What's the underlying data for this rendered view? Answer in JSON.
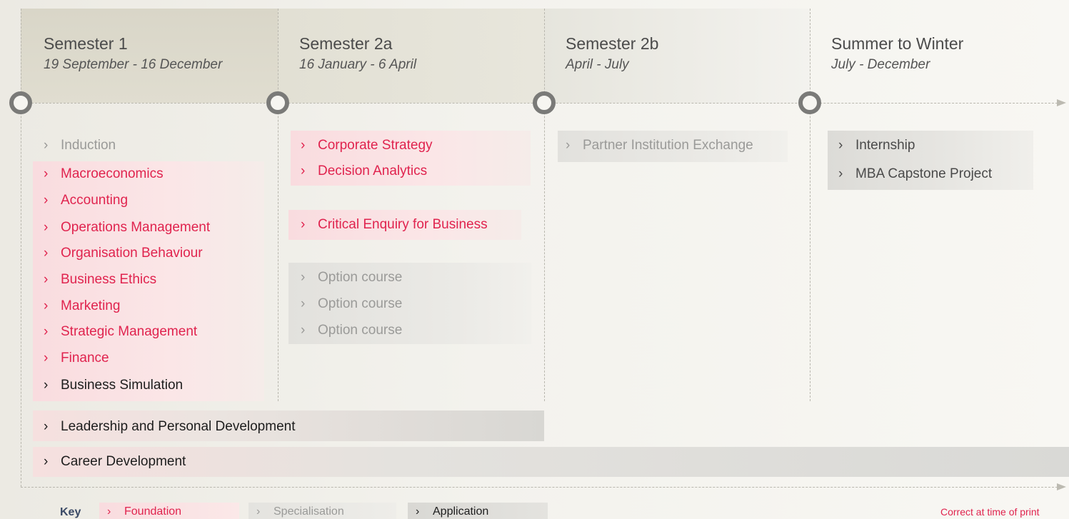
{
  "semesters": [
    {
      "title": "Semester 1",
      "dates": "19 September - 16 December"
    },
    {
      "title": "Semester 2a",
      "dates": "16 January - 6 April"
    },
    {
      "title": "Semester 2b",
      "dates": "April - July"
    },
    {
      "title": "Summer to Winter",
      "dates": "July - December"
    }
  ],
  "chevron": "›",
  "semester1_courses": [
    {
      "label": "Induction",
      "type": "specialisation"
    },
    {
      "label": "Macroeconomics",
      "type": "foundation"
    },
    {
      "label": "Accounting",
      "type": "foundation"
    },
    {
      "label": "Operations Management",
      "type": "foundation"
    },
    {
      "label": "Organisation Behaviour",
      "type": "foundation"
    },
    {
      "label": "Business Ethics",
      "type": "foundation"
    },
    {
      "label": "Marketing",
      "type": "foundation"
    },
    {
      "label": "Strategic Management",
      "type": "foundation"
    },
    {
      "label": "Finance",
      "type": "foundation"
    },
    {
      "label": "Business Simulation",
      "type": "application"
    }
  ],
  "semester2a_courses": {
    "group1": [
      "Corporate Strategy",
      "Decision Analytics"
    ],
    "group2": [
      "Critical Enquiry for Business"
    ],
    "options": [
      "Option course",
      "Option course",
      "Option course"
    ]
  },
  "semester2b_courses": [
    "Partner Institution Exchange"
  ],
  "summer_courses": [
    "Internship",
    "MBA Capstone Project"
  ],
  "spanning": {
    "leadership": "Leadership and Personal Development",
    "career": "Career Development"
  },
  "key": {
    "label": "Key",
    "foundation": "Foundation",
    "specialisation": "Specialisation",
    "application": "Application"
  },
  "note": "Correct at time of print",
  "colors": {
    "foundation": "#e0234e",
    "specialisation": "#9a9a98",
    "application": "#1d1d1d",
    "node": "#7a7a78"
  }
}
